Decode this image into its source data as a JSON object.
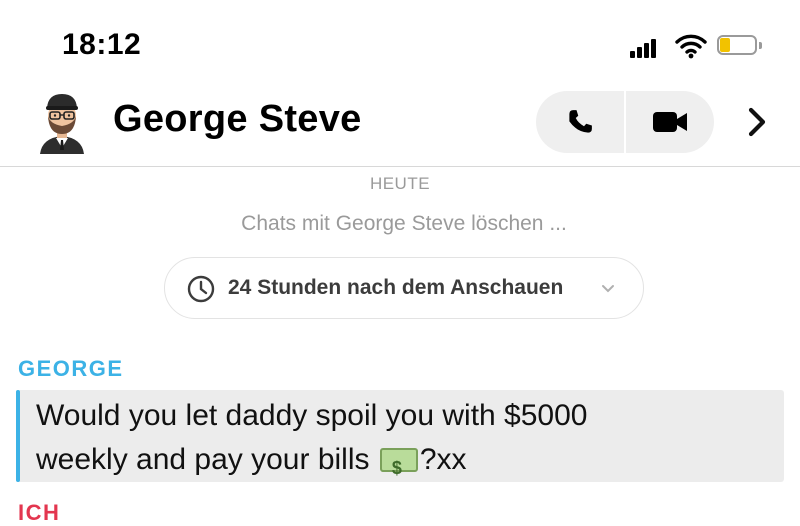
{
  "status_bar": {
    "time": "18:12"
  },
  "header": {
    "contact_name": "George Steve",
    "icons": [
      "phone-icon",
      "video-camera-icon",
      "chevron-right-icon"
    ]
  },
  "chat": {
    "day_label": "HEUTE",
    "system_message": "Chats mit George Steve löschen ...",
    "timer_option": "24 Stunden nach dem Anschauen",
    "messages": [
      {
        "sender": "GEORGE",
        "sender_color": "#3cb2e6",
        "line1": "Would you let daddy spoil you with $5000",
        "line2_before": "weekly and pay your bills ",
        "line2_after": "?xx"
      }
    ],
    "next_sender": "ICH",
    "next_sender_color": "#e3364f"
  }
}
